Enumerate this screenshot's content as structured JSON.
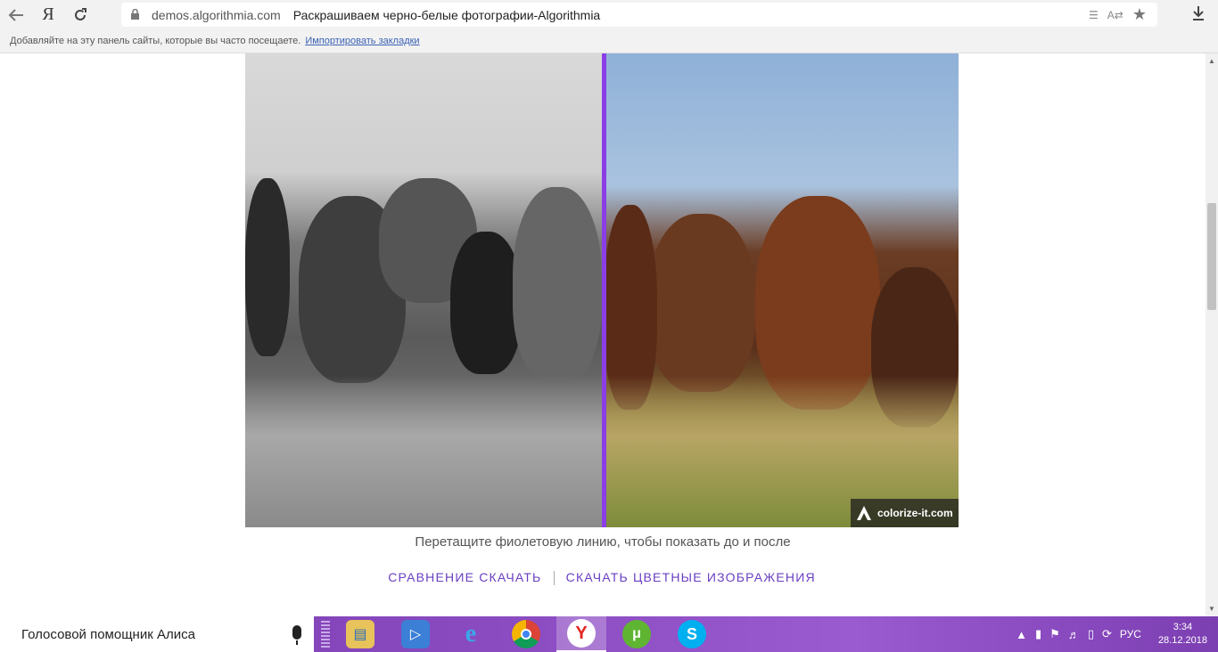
{
  "browser": {
    "back_icon": "arrow-left-icon",
    "yandex_label": "Я",
    "reload_icon": "reload-icon",
    "url": "demos.algorithmia.com",
    "page_title": "Раскрашиваем черно-белые фотографии-Algorithmia",
    "reader_icon": "reader-mode-icon",
    "translate_icon": "translate-icon",
    "bookmark_icon": "star-icon",
    "download_icon": "download-icon"
  },
  "bookmarks_bar": {
    "text": "Добавляйте на эту панель сайты, которые вы часто посещаете.",
    "import_link": "Импортировать закладки"
  },
  "content": {
    "watermark": "colorize-it.com",
    "caption": "Перетащите фиолетовую линию, чтобы показать до и после",
    "link_compare": "СРАВНЕНИЕ СКАЧАТЬ",
    "link_download": "СКАЧАТЬ ЦВЕТНЫЕ ИЗОБРАЖЕНИЯ",
    "divider_color": "#8b3ee6"
  },
  "taskbar": {
    "search_text": "Голосовой помощник Алиса",
    "apps": [
      "explorer",
      "speaker",
      "internet-explorer",
      "chrome",
      "yandex-browser",
      "utorrent",
      "skype"
    ],
    "lang": "РУС",
    "time": "3:34",
    "date": "28.12.2018"
  }
}
